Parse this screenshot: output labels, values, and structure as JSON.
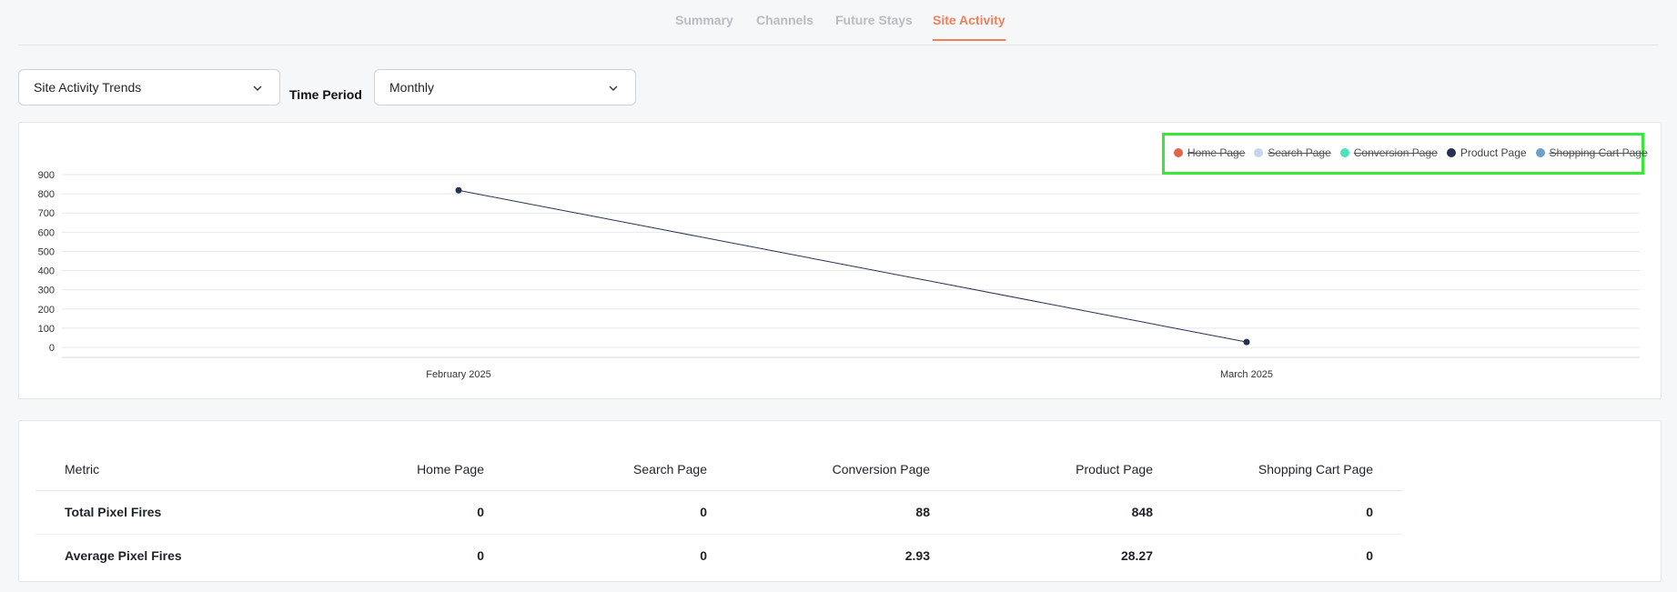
{
  "tabs": [
    {
      "label": "Summary",
      "active": false
    },
    {
      "label": "Channels",
      "active": false
    },
    {
      "label": "Future Stays",
      "active": false
    },
    {
      "label": "Site Activity",
      "active": true
    }
  ],
  "filters": {
    "metric_select": "Site Activity Trends",
    "time_period_label": "Time Period",
    "time_period_select": "Monthly"
  },
  "legend": [
    {
      "label": "Home Page",
      "color": "#e0654a",
      "hidden": true
    },
    {
      "label": "Search Page",
      "color": "#c5d6ea",
      "hidden": true
    },
    {
      "label": "Conversion Page",
      "color": "#4ee2b7",
      "hidden": true
    },
    {
      "label": "Product Page",
      "color": "#263150",
      "hidden": false
    },
    {
      "label": "Shopping Cart Page",
      "color": "#6ca0c8",
      "hidden": true
    }
  ],
  "chart_data": {
    "type": "line",
    "categories": [
      "February 2025",
      "March 2025"
    ],
    "series": [
      {
        "name": "Product Page",
        "values": [
          818,
          28
        ],
        "color": "#263150"
      }
    ],
    "ylim": [
      0,
      900
    ],
    "yticks": [
      0,
      100,
      200,
      300,
      400,
      500,
      600,
      700,
      800,
      900
    ],
    "grid": true,
    "legend_position": "top-right"
  },
  "table": {
    "headers": [
      "Metric",
      "Home Page",
      "Search Page",
      "Conversion Page",
      "Product Page",
      "Shopping Cart Page"
    ],
    "rows": [
      [
        "Total Pixel Fires",
        "0",
        "0",
        "88",
        "848",
        "0"
      ],
      [
        "Average Pixel Fires",
        "0",
        "0",
        "2.93",
        "28.27",
        "0"
      ]
    ]
  }
}
